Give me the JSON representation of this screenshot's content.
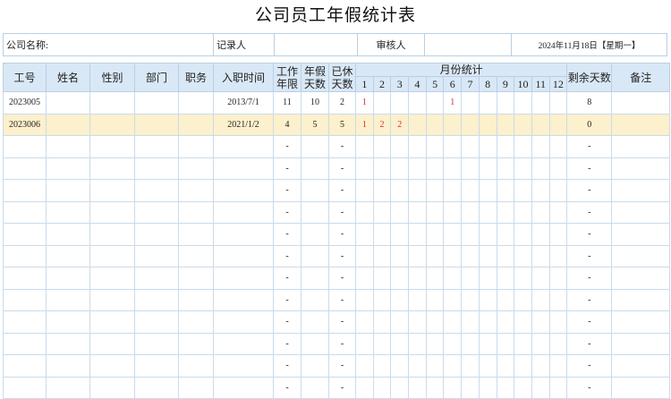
{
  "title": "公司员工年假统计表",
  "info": {
    "company_label": "公司名称:",
    "recorder_label": "记录人",
    "reviewer_label": "审核人",
    "date": "2024年11月18日【星期一】"
  },
  "headers": {
    "emp_id": "工号",
    "name": "姓名",
    "gender": "性别",
    "dept": "部门",
    "position": "职务",
    "hire_date": "入职时间",
    "work_years": "工作年限",
    "annual_days": "年假天数",
    "used_days": "已休天数",
    "monthly": "月份统计",
    "months": [
      "1",
      "2",
      "3",
      "4",
      "5",
      "6",
      "7",
      "8",
      "9",
      "10",
      "11",
      "12"
    ],
    "remaining": "剩余天数",
    "notes": "备注"
  },
  "rows": [
    {
      "emp_id": "2023005",
      "name": "",
      "gender": "",
      "dept": "",
      "position": "",
      "hire_date": "2013/7/1",
      "work_years": "11",
      "annual_days": "10",
      "used_days": "2",
      "months": [
        "1",
        "",
        "",
        "",
        "",
        "1",
        "",
        "",
        "",
        "",
        "",
        ""
      ],
      "remaining": "8",
      "notes": "",
      "highlight": false
    },
    {
      "emp_id": "2023006",
      "name": "",
      "gender": "",
      "dept": "",
      "position": "",
      "hire_date": "2021/1/2",
      "work_years": "4",
      "annual_days": "5",
      "used_days": "5",
      "months": [
        "1",
        "2",
        "2",
        "",
        "",
        "",
        "",
        "",
        "",
        "",
        "",
        ""
      ],
      "remaining": "0",
      "notes": "",
      "highlight": true
    },
    {
      "emp_id": "",
      "name": "",
      "gender": "",
      "dept": "",
      "position": "",
      "hire_date": "",
      "work_years": "-",
      "annual_days": "",
      "used_days": "-",
      "months": [
        "",
        "",
        "",
        "",
        "",
        "",
        "",
        "",
        "",
        "",
        "",
        ""
      ],
      "remaining": "-",
      "notes": "",
      "highlight": false
    },
    {
      "emp_id": "",
      "name": "",
      "gender": "",
      "dept": "",
      "position": "",
      "hire_date": "",
      "work_years": "-",
      "annual_days": "",
      "used_days": "-",
      "months": [
        "",
        "",
        "",
        "",
        "",
        "",
        "",
        "",
        "",
        "",
        "",
        ""
      ],
      "remaining": "-",
      "notes": "",
      "highlight": false
    },
    {
      "emp_id": "",
      "name": "",
      "gender": "",
      "dept": "",
      "position": "",
      "hire_date": "",
      "work_years": "-",
      "annual_days": "",
      "used_days": "-",
      "months": [
        "",
        "",
        "",
        "",
        "",
        "",
        "",
        "",
        "",
        "",
        "",
        ""
      ],
      "remaining": "-",
      "notes": "",
      "highlight": false
    },
    {
      "emp_id": "",
      "name": "",
      "gender": "",
      "dept": "",
      "position": "",
      "hire_date": "",
      "work_years": "-",
      "annual_days": "",
      "used_days": "-",
      "months": [
        "",
        "",
        "",
        "",
        "",
        "",
        "",
        "",
        "",
        "",
        "",
        ""
      ],
      "remaining": "-",
      "notes": "",
      "highlight": false
    },
    {
      "emp_id": "",
      "name": "",
      "gender": "",
      "dept": "",
      "position": "",
      "hire_date": "",
      "work_years": "-",
      "annual_days": "",
      "used_days": "-",
      "months": [
        "",
        "",
        "",
        "",
        "",
        "",
        "",
        "",
        "",
        "",
        "",
        ""
      ],
      "remaining": "-",
      "notes": "",
      "highlight": false
    },
    {
      "emp_id": "",
      "name": "",
      "gender": "",
      "dept": "",
      "position": "",
      "hire_date": "",
      "work_years": "-",
      "annual_days": "",
      "used_days": "-",
      "months": [
        "",
        "",
        "",
        "",
        "",
        "",
        "",
        "",
        "",
        "",
        "",
        ""
      ],
      "remaining": "-",
      "notes": "",
      "highlight": false
    },
    {
      "emp_id": "",
      "name": "",
      "gender": "",
      "dept": "",
      "position": "",
      "hire_date": "",
      "work_years": "-",
      "annual_days": "",
      "used_days": "-",
      "months": [
        "",
        "",
        "",
        "",
        "",
        "",
        "",
        "",
        "",
        "",
        "",
        ""
      ],
      "remaining": "-",
      "notes": "",
      "highlight": false
    },
    {
      "emp_id": "",
      "name": "",
      "gender": "",
      "dept": "",
      "position": "",
      "hire_date": "",
      "work_years": "-",
      "annual_days": "",
      "used_days": "-",
      "months": [
        "",
        "",
        "",
        "",
        "",
        "",
        "",
        "",
        "",
        "",
        "",
        ""
      ],
      "remaining": "-",
      "notes": "",
      "highlight": false
    },
    {
      "emp_id": "",
      "name": "",
      "gender": "",
      "dept": "",
      "position": "",
      "hire_date": "",
      "work_years": "-",
      "annual_days": "",
      "used_days": "-",
      "months": [
        "",
        "",
        "",
        "",
        "",
        "",
        "",
        "",
        "",
        "",
        "",
        ""
      ],
      "remaining": "-",
      "notes": "",
      "highlight": false
    },
    {
      "emp_id": "",
      "name": "",
      "gender": "",
      "dept": "",
      "position": "",
      "hire_date": "",
      "work_years": "-",
      "annual_days": "",
      "used_days": "-",
      "months": [
        "",
        "",
        "",
        "",
        "",
        "",
        "",
        "",
        "",
        "",
        "",
        ""
      ],
      "remaining": "-",
      "notes": "",
      "highlight": false
    },
    {
      "emp_id": "",
      "name": "",
      "gender": "",
      "dept": "",
      "position": "",
      "hire_date": "",
      "work_years": "-",
      "annual_days": "",
      "used_days": "-",
      "months": [
        "",
        "",
        "",
        "",
        "",
        "",
        "",
        "",
        "",
        "",
        "",
        ""
      ],
      "remaining": "-",
      "notes": "",
      "highlight": false
    },
    {
      "emp_id": "",
      "name": "",
      "gender": "",
      "dept": "",
      "position": "",
      "hire_date": "",
      "work_years": "-",
      "annual_days": "",
      "used_days": "-",
      "months": [
        "",
        "",
        "",
        "",
        "",
        "",
        "",
        "",
        "",
        "",
        "",
        ""
      ],
      "remaining": "-",
      "notes": "",
      "highlight": false
    }
  ],
  "colors": {
    "header_bg": "#d9e8f6",
    "highlight_row": "#fdf0cc",
    "month_mark": "#d03030",
    "grid_line": "#c9dbeb"
  }
}
